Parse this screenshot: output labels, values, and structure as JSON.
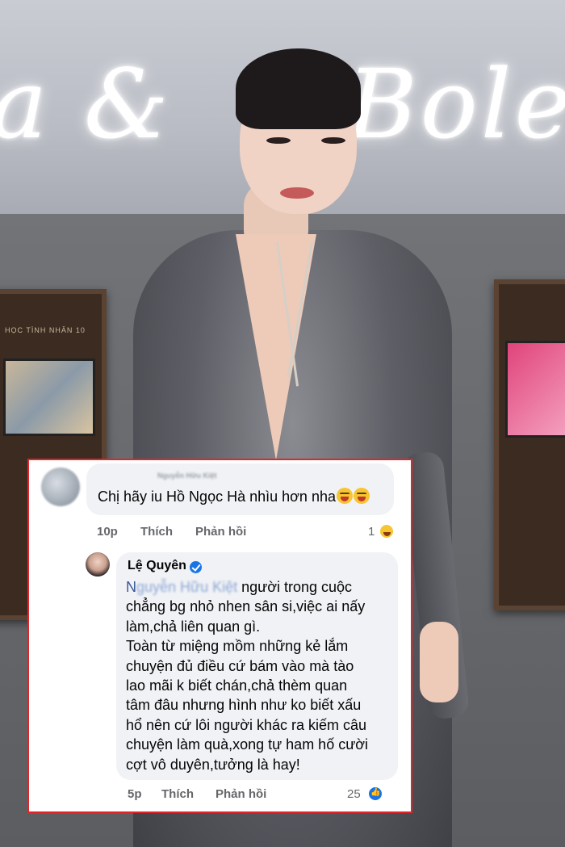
{
  "background": {
    "neon_left": "a &",
    "neon_right": "Bolero",
    "frame_label": "HỌC TÌNH NHÂN 10"
  },
  "comment_1": {
    "author_blurred": "Nguyễn Hữu Kiệt",
    "text": "Chị hãy iu Hồ Ngọc Hà nhìu hơn nha",
    "emojis": [
      "squinting-tongue-emoji",
      "squinting-tongue-emoji"
    ],
    "time": "10p",
    "like_label": "Thích",
    "reply_label": "Phản hồi",
    "reaction_count": "1",
    "reaction_type": "haha"
  },
  "comment_2": {
    "author": "Lệ Quyên",
    "verified": true,
    "tag_visible": "N",
    "tag_blurred": "guyễn Hữu Kiệt",
    "lines": [
      " người trong cuộc",
      "chẳng bg nhỏ nhen sân si,việc ai nấy",
      "làm,chả liên quan gì.",
      "Toàn từ miệng mồm những kẻ lắm",
      "chuyện đủ điều cứ bám vào mà tào",
      "lao mãi k biết chán,chả thèm quan",
      "tâm đâu nhưng hình như ko biết xấu",
      "hổ nên cứ lôi người khác ra kiếm câu",
      "chuyện làm quà,xong tự ham hố cười",
      "cợt vô duyên,tưởng là hay!"
    ],
    "time": "5p",
    "like_label": "Thích",
    "reply_label": "Phản hồi",
    "reaction_count": "25",
    "reaction_type": "like"
  },
  "colors": {
    "card_border": "#e0262b",
    "bubble": "#f0f2f5",
    "meta_text": "#65676b",
    "like_blue": "#1b74e4"
  }
}
